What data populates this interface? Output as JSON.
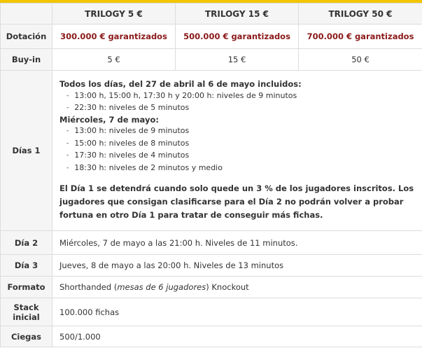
{
  "header": {
    "col0": "",
    "col1": "TRILOGY 5 €",
    "col2": "TRILOGY 15 €",
    "col3": "TRILOGY 50 €"
  },
  "rows": {
    "dotacion": {
      "label": "Dotación",
      "v1": "300.000 € garantizados",
      "v2": "500.000 € garantizados",
      "v3": "700.000 € garantizados"
    },
    "buyin": {
      "label": "Buy-in",
      "v1": "5 €",
      "v2": "15 €",
      "v3": "50 €"
    },
    "dia1": {
      "label": "Días 1",
      "heading1": "Todos los días, del 27 de abril al 6 de mayo incluidos:",
      "list1": [
        {
          "prefix": "13:00 h, 15:00 h, 17:30 h y 20:00 h",
          "rest": ": niveles de 9 minutos"
        },
        {
          "prefix": "22:30 h",
          "rest": ": niveles de 5 minutos"
        }
      ],
      "heading2": "Miércoles, 7 de mayo:",
      "list2": [
        {
          "prefix": "13:00 h",
          "rest": ": niveles de 9 minutos"
        },
        {
          "prefix": "15:00 h",
          "rest": ": niveles de 8 minutos"
        },
        {
          "prefix": "17:30 h",
          "rest": ": niveles de 4 minutos"
        },
        {
          "prefix": "18:30 h",
          "rest": ": niveles de 2 minutos y medio"
        }
      ],
      "note": "El Día 1 se detendrá cuando solo quede un 3 % de los jugadores inscritos. Los jugadores que consigan clasificarse para el Día 2 no podrán volver a probar fortuna en otro Día 1 para tratar de conseguir más fichas."
    },
    "dia2": {
      "label": "Día 2",
      "value": "Miércoles, 7 de mayo a  las 21:00 h. Niveles de 11 minutos."
    },
    "dia3": {
      "label": "Día 3",
      "value": "Jueves, 8 de mayo a las 20:00 h. Niveles de 13 minutos"
    },
    "formato": {
      "label": "Formato",
      "value_a": "Shorthanded (",
      "value_b": "mesas de 6 jugadores",
      "value_c": ") Knockout"
    },
    "stack": {
      "label": "Stack inicial",
      "value": "100.000 fichas"
    },
    "ciegas": {
      "label": "Ciegas",
      "value": "500/1.000"
    }
  },
  "colors": {
    "accent_yellow": "#f2c500",
    "prize_red": "#8b1a1a",
    "label_bg": "#f5f5f5",
    "border": "#dcdcdc"
  }
}
